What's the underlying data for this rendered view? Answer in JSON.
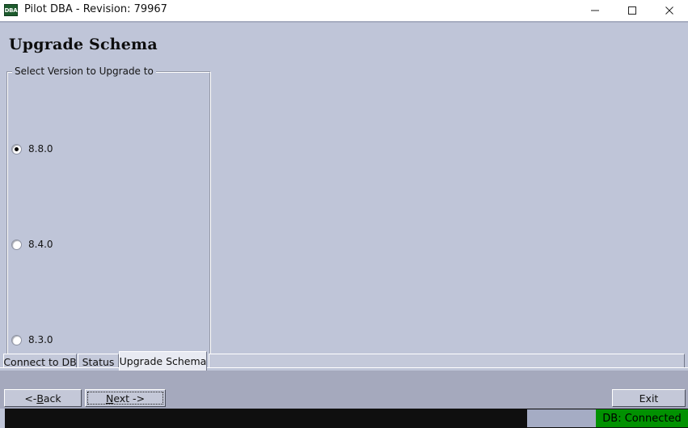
{
  "window": {
    "title": "Pilot DBA - Revision: 79967",
    "icon_label": "DBA",
    "icon_name": "app-icon-dba",
    "controls": {
      "minimize": "minimize-icon",
      "maximize": "maximize-icon",
      "close": "close-icon"
    }
  },
  "page": {
    "heading": "Upgrade Schema"
  },
  "groupbox": {
    "legend": "Select Version to Upgrade to",
    "options": [
      {
        "label": "8.8.0",
        "selected": true
      },
      {
        "label": "8.4.0",
        "selected": false
      },
      {
        "label": "8.3.0",
        "selected": false
      }
    ]
  },
  "tabs": [
    {
      "label": "Connect to DB",
      "active": false
    },
    {
      "label": "Status",
      "active": false
    },
    {
      "label": "Upgrade Schema",
      "active": true
    }
  ],
  "buttons": {
    "back": {
      "prefix": "<- ",
      "mnemonic": "B",
      "suffix": "ack"
    },
    "next": {
      "prefix": "",
      "mnemonic": "N",
      "suffix": "ext ->"
    },
    "exit": "Exit"
  },
  "statusbar": {
    "db_status": "DB: Connected",
    "db_status_color": "#019101"
  },
  "colors": {
    "window_background": "#bfc5d8",
    "titlebar_background": "#ffffff",
    "buttonbar_background": "#a5a9bd",
    "statusbar_background": "#0f0f0f",
    "active_tab_background": "#e8eaf2"
  }
}
